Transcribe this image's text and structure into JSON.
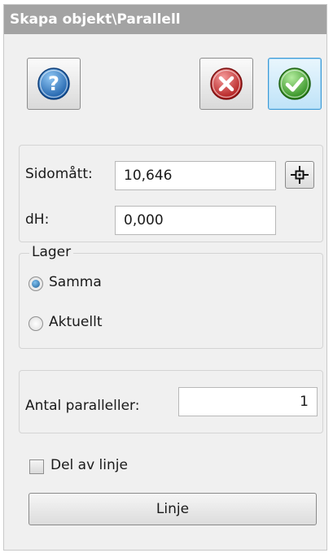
{
  "window": {
    "title": "Skapa objekt\\Parallell"
  },
  "toolbar": {
    "help_icon": "question-mark",
    "cancel_icon": "red-x",
    "ok_icon": "green-check"
  },
  "measure": {
    "sidomatt_label": "Sidomått:",
    "sidomatt_value": "10,646",
    "pick_icon": "crosshair",
    "dh_label": "dH:",
    "dh_value": "0,000"
  },
  "lager": {
    "title": "Lager",
    "options": [
      {
        "label": "Samma",
        "selected": true
      },
      {
        "label": "Aktuellt",
        "selected": false
      }
    ]
  },
  "parallels": {
    "label": "Antal paralleller:",
    "value": "1"
  },
  "part_of_line": {
    "label": "Del av linje",
    "checked": false
  },
  "line_button": {
    "label": "Linje"
  },
  "colors": {
    "titlebar": "#a3a3a3",
    "panel": "#f0f0f0",
    "help_blue": "#1f6fbf",
    "cancel_red": "#d92b2b",
    "ok_green": "#3fae2a",
    "hot_border": "#3c9ad6"
  }
}
